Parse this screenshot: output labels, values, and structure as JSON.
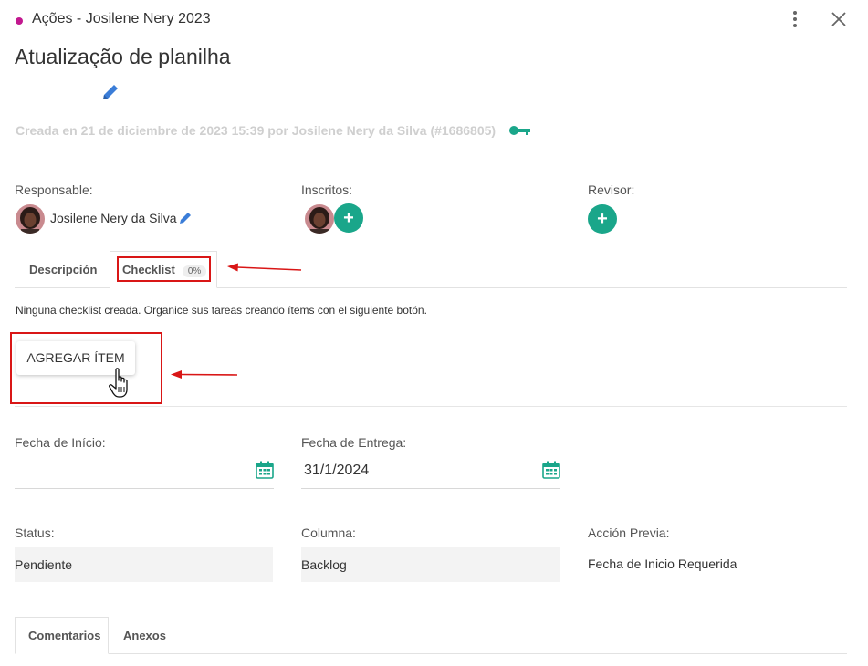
{
  "header": {
    "project_name": "Ações - Josilene Nery 2023",
    "project_color": "#c2188f",
    "menu_icon": "more-vertical-icon",
    "close_icon": "close-icon"
  },
  "task": {
    "title": "Atualização de planilha",
    "created_info": "Creada en 21 de diciembre de 2023 15:39 por Josilene Nery da Silva (#1686805)"
  },
  "people": {
    "responsible_label": "Responsable:",
    "responsible_name": "Josilene Nery da Silva",
    "subscribers_label": "Inscritos:",
    "reviewer_label": "Revisor:",
    "add_symbol": "+"
  },
  "tabs": {
    "description": "Descripción",
    "checklist": "Checklist",
    "checklist_percent": "0%"
  },
  "checklist": {
    "empty_message": "Ninguna checklist creada. Organice sus tareas creando ítems con el siguiente botón.",
    "add_button": "AGREGAR ÍTEM"
  },
  "dates": {
    "start_label": "Fecha de Início:",
    "start_value": "",
    "due_label": "Fecha de Entrega:",
    "due_value": "31/1/2024"
  },
  "status": {
    "status_label": "Status:",
    "status_value": "Pendiente",
    "column_label": "Columna:",
    "column_value": "Backlog",
    "prev_label": "Acción Previa:",
    "prev_value": "Fecha de Inicio Requerida"
  },
  "bottom_tabs": {
    "comments": "Comentarios",
    "attachments": "Anexos"
  },
  "colors": {
    "accent": "#1aa68a",
    "highlight": "#d91616",
    "edit_blue": "#3b7dd8"
  }
}
